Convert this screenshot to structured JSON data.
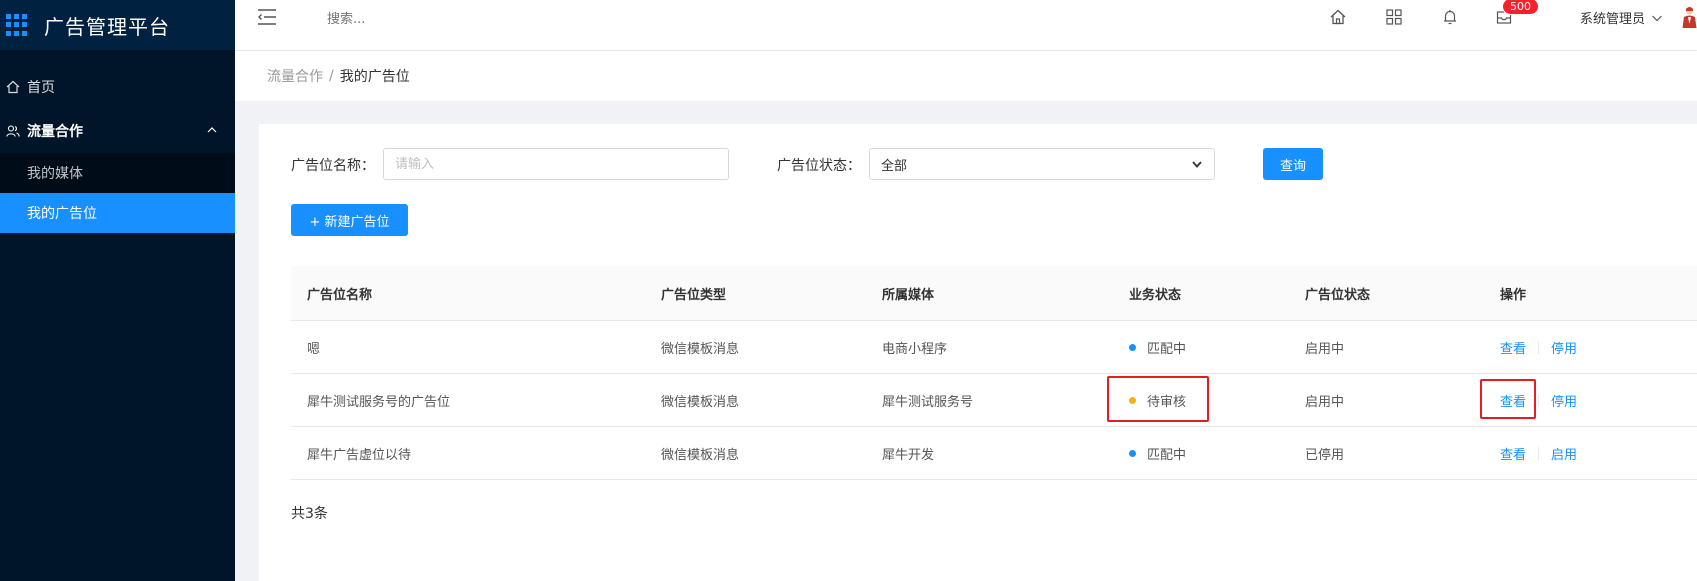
{
  "app": {
    "title": "广告管理平台"
  },
  "sidebar": {
    "items": [
      {
        "label": "首页",
        "icon": "home-icon"
      }
    ],
    "group": {
      "label": "流量合作",
      "icon": "users-icon",
      "expanded": true
    },
    "subitems": [
      {
        "label": "我的媒体",
        "active": false
      },
      {
        "label": "我的广告位",
        "active": true
      }
    ]
  },
  "header": {
    "search_placeholder": "搜索...",
    "badge": "500",
    "user": "系统管理员",
    "icons": [
      "home-icon",
      "apps-grid-icon",
      "bell-icon",
      "inbox-icon"
    ]
  },
  "breadcrumb": {
    "parent": "流量合作",
    "separator": "/",
    "current": "我的广告位"
  },
  "filters": {
    "name_label": "广告位名称：",
    "name_placeholder": "请输入",
    "status_label": "广告位状态：",
    "status_value": "全部",
    "query_button": "查询"
  },
  "new_button": "+ 新建广告位",
  "table": {
    "columns": [
      "广告位名称",
      "广告位类型",
      "所属媒体",
      "业务状态",
      "广告位状态",
      "操作"
    ],
    "rows": [
      {
        "name": "嗯",
        "type": "微信模板消息",
        "media": "电商小程序",
        "biz_status": "匹配中",
        "biz_color": "#1890ff",
        "slot_status": "启用中",
        "view": "查看",
        "toggle": "停用"
      },
      {
        "name": "犀牛测试服务号的广告位",
        "type": "微信模板消息",
        "media": "犀牛测试服务号",
        "biz_status": "待审核",
        "biz_color": "#faad14",
        "slot_status": "启用中",
        "view": "查看",
        "toggle": "停用"
      },
      {
        "name": "犀牛广告虚位以待",
        "type": "微信模板消息",
        "media": "犀牛开发",
        "biz_status": "匹配中",
        "biz_color": "#1890ff",
        "slot_status": "已停用",
        "view": "查看",
        "toggle": "启用"
      }
    ]
  },
  "total": "共3条",
  "colors": {
    "accent": "#1890ff",
    "sidebar_bg": "#001529",
    "highlight": "#e51c23"
  }
}
